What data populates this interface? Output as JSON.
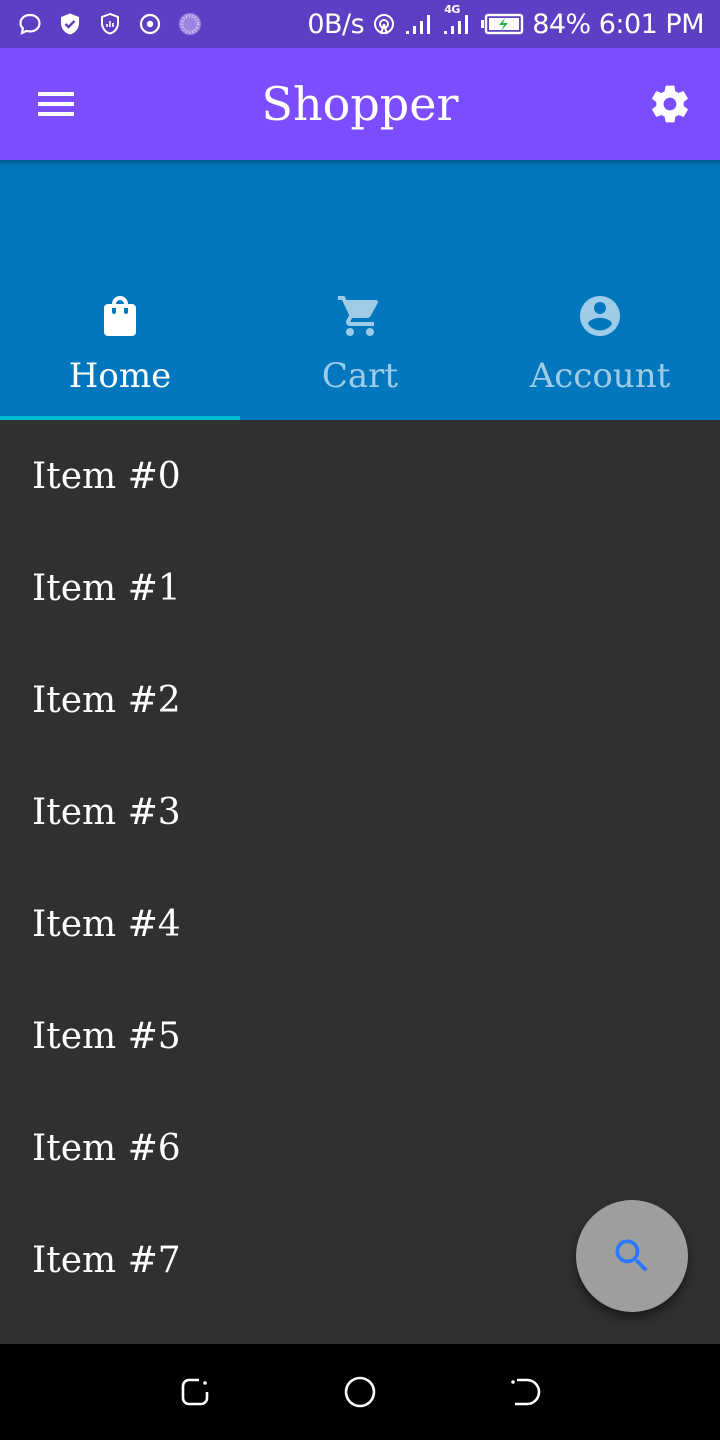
{
  "status_bar": {
    "net_speed": "0B/s",
    "network_type": "4G",
    "battery": "84%",
    "time": "6:01 PM",
    "icons": [
      "chat-bubble-icon",
      "shield-check-icon",
      "shield-stats-icon",
      "target-icon",
      "spinner-icon",
      "hotspot-icon",
      "signal-icon",
      "signal-4g-icon",
      "battery-charging-icon"
    ]
  },
  "app_bar": {
    "title": "Shopper",
    "menu_icon": "menu-icon",
    "settings_icon": "gear-icon"
  },
  "tabs": [
    {
      "label": "Home",
      "icon": "shopping-bag-icon",
      "active": true
    },
    {
      "label": "Cart",
      "icon": "cart-icon",
      "active": false
    },
    {
      "label": "Account",
      "icon": "account-circle-icon",
      "active": false
    }
  ],
  "list": {
    "items": [
      "Item #0",
      "Item #1",
      "Item #2",
      "Item #3",
      "Item #4",
      "Item #5",
      "Item #6",
      "Item #7"
    ]
  },
  "fab": {
    "icon": "search-icon"
  },
  "nav_bar": {
    "icons": [
      "recent-apps-icon",
      "home-circle-icon",
      "back-icon"
    ]
  },
  "colors": {
    "status_bar": "#5d3fc4",
    "app_bar": "#7c4dff",
    "header": "#0277bd",
    "tab_indicator": "#00bcd4",
    "list_background": "#303030",
    "fab_background": "#9e9e9e",
    "fab_icon": "#2979ff",
    "nav_bar": "#000000"
  }
}
